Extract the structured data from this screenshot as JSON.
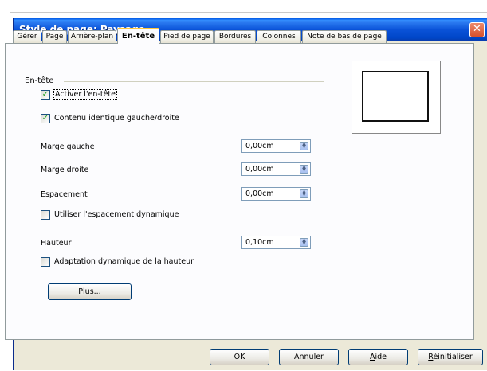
{
  "window": {
    "title": "Style de page: Paysage",
    "close_glyph": "✕"
  },
  "tabs": [
    {
      "label": "Gérer",
      "active": false
    },
    {
      "label": "Page",
      "active": false
    },
    {
      "label": "Arrière-plan",
      "active": false
    },
    {
      "label": "En-tête",
      "active": true
    },
    {
      "label": "Pied de page",
      "active": false
    },
    {
      "label": "Bordures",
      "active": false
    },
    {
      "label": "Colonnes",
      "active": false
    },
    {
      "label": "Note de bas de page",
      "active": false
    }
  ],
  "section": {
    "title": "En-tête"
  },
  "checkboxes": {
    "activate_header": {
      "label": "Activer l'en-tête",
      "checked": true
    },
    "same_content": {
      "label": "Contenu identique gauche/droite",
      "checked": true
    },
    "dynamic_spacing": {
      "label": "Utiliser l'espacement dynamique",
      "checked": false
    },
    "dynamic_height": {
      "label": "Adaptation dynamique de la hauteur",
      "checked": false
    }
  },
  "fields": {
    "left_margin": {
      "label": "Marge gauche",
      "value": "0,00cm"
    },
    "right_margin": {
      "label": "Marge droite",
      "value": "0,00cm"
    },
    "spacing": {
      "label": "Espacement",
      "value": "0,00cm"
    },
    "height": {
      "label": "Hauteur",
      "value": "0,10cm"
    }
  },
  "buttons": {
    "more": "Plus...",
    "ok": "OK",
    "cancel": "Annuler",
    "help": "Aide",
    "reset": "Réinitialiser"
  },
  "icons": {
    "check": "✓",
    "spin": "▲▼"
  }
}
